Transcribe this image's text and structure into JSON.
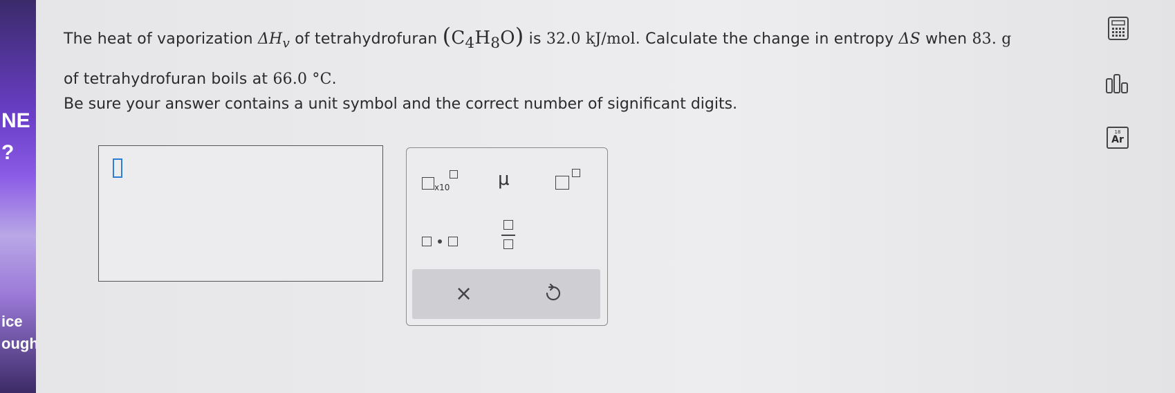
{
  "sidebar": {
    "fragment1": "NE",
    "fragment2": "?",
    "fragment3": "ice",
    "fragment4": "ough"
  },
  "question": {
    "line1_pre": "The heat of vaporization",
    "dhv": "ΔH",
    "dhv_sub": "v",
    "line1_mid": "of tetrahydrofuran",
    "formula_open": "(",
    "c": "C",
    "c_sub": "4",
    "h": "H",
    "h_sub": "8",
    "o": "O",
    "formula_close": ")",
    "is": "is",
    "value": "32.0 kJ/mol",
    "line1_post": ". Calculate the change in entropy",
    "ds": "ΔS",
    "when": "when",
    "mass": "83. g",
    "line2_pre": "of tetrahydrofuran boils at",
    "temp": "66.0 °C",
    "line2_post": "."
  },
  "instruction": "Be sure your answer contains a unit symbol and the correct number of significant digits.",
  "tools": {
    "x10_label": "x10",
    "mu": "μ",
    "clear": "×"
  },
  "side": {
    "periodic_num": "18",
    "periodic_sym": "Ar"
  }
}
